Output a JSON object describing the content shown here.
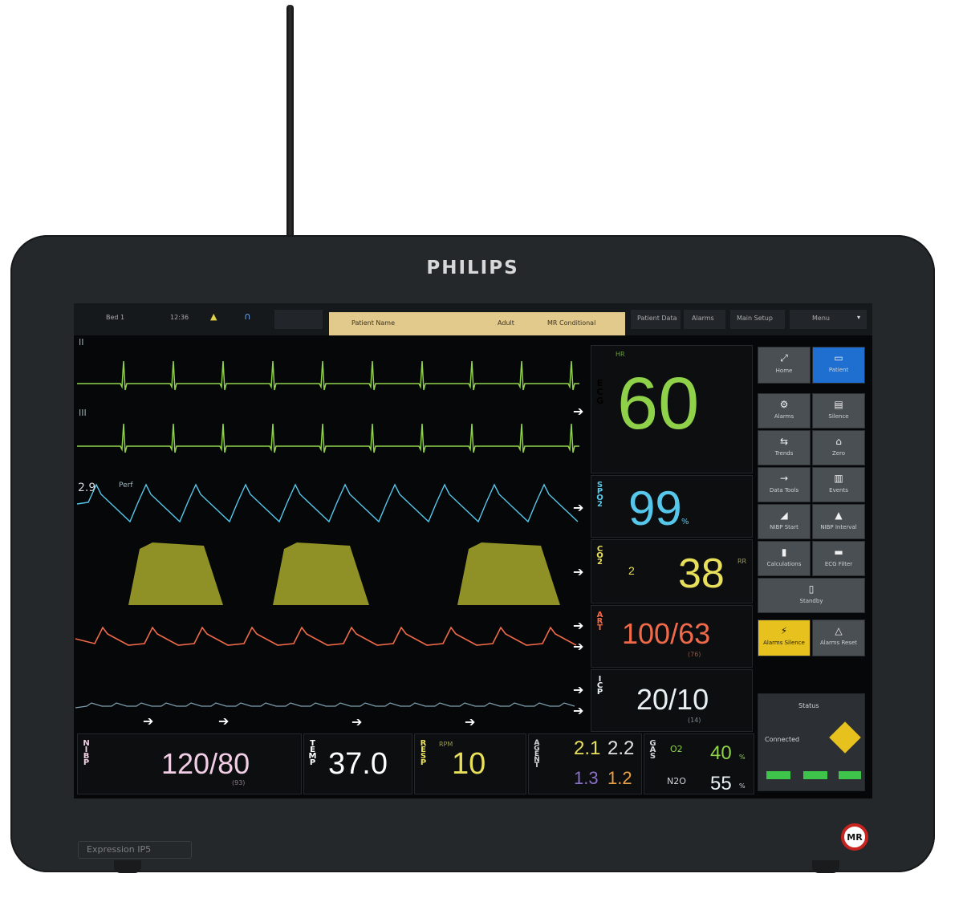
{
  "device": {
    "brand": "PHILIPS",
    "model": "Expression IP5",
    "mr_badge": "MR"
  },
  "topbar": {
    "bed": "Bed 1",
    "time": "12:36",
    "banner_left": "Patient Name",
    "banner_mid": "Adult",
    "banner_right": "MR Conditional",
    "btn_patient": "Patient Data",
    "btn_alarms": "Alarms",
    "btn_main": "Main Setup",
    "btn_menu": "Menu"
  },
  "colors": {
    "ecg": "#8fd24a",
    "spo2": "#56c7ea",
    "co2": "#e8e05a",
    "art": "#f06a4a",
    "icp": "#e8f0f4",
    "nibp": "#f1cde6",
    "temp": "#ffffff",
    "resp": "#e8e05a"
  },
  "waves": {
    "ecg_lead1": "II",
    "ecg_lead2": "III",
    "pleth_scale": "2.9",
    "pleth_label": "Perf"
  },
  "ecg": {
    "label": "ECG",
    "unit": "HR",
    "value": "60"
  },
  "spo2": {
    "label": "SPO2",
    "value": "99",
    "unit": "%"
  },
  "co2": {
    "label": "CO2",
    "insp": "2",
    "value": "38",
    "unit": "RR"
  },
  "art": {
    "label": "ART",
    "value": "100/63",
    "mean": "(76)"
  },
  "icp": {
    "label": "ICP",
    "value": "20/10",
    "mean": "(14)"
  },
  "nibp": {
    "label": "NIBP",
    "value": "120/80",
    "mean": "(93)"
  },
  "temp": {
    "label": "TEMP",
    "value": "37.0"
  },
  "resp": {
    "label": "RESP",
    "unit": "RPM",
    "value": "10"
  },
  "agent": {
    "label": "AGENT",
    "row1_a": "2.1",
    "row1_b": "2.2",
    "row2_a": "1.3",
    "row2_b": "1.2"
  },
  "gas": {
    "label": "GAS",
    "o2_label": "O2",
    "o2_value": "40",
    "n2o_label": "N2O",
    "n2o_value": "55",
    "unit": "%"
  },
  "side": {
    "btn_top_left": "Home",
    "btn_top_right": "Patient",
    "buttons": [
      "Alarms",
      "Silence",
      "Trends",
      "Zero",
      "Data Tools",
      "Events",
      "NIBP Start",
      "NIBP Interval",
      "Calculations",
      "ECG Filter",
      "Standby"
    ],
    "alarm_btn": "Alarms Silence",
    "alarm_btn2": "Alarms Reset",
    "status_title": "Status",
    "status_line": "Connected"
  }
}
